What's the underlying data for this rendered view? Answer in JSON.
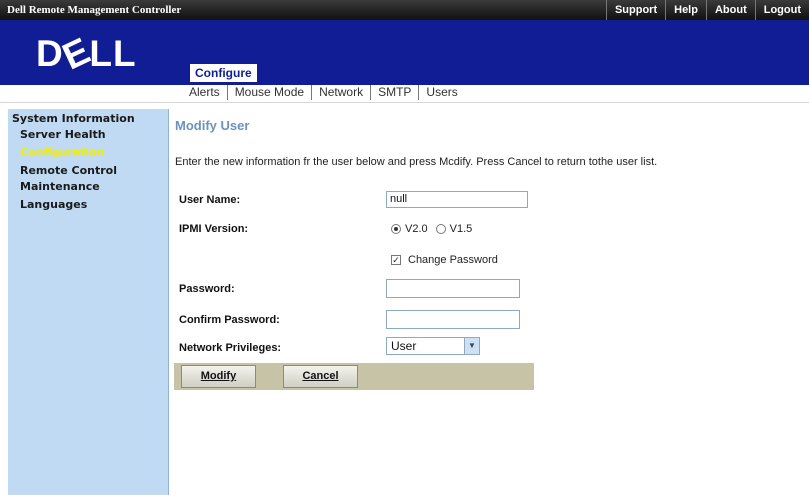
{
  "topbar": {
    "app_title": "Dell Remote Management Controller",
    "links": [
      "Support",
      "Help",
      "About",
      "Logout"
    ]
  },
  "header": {
    "logo": "DELL",
    "active_tab": "Configure",
    "subnav": [
      "Alerts",
      "Mouse Mode",
      "Network",
      "SMTP",
      "Users"
    ]
  },
  "sidebar": {
    "items": [
      "System Information",
      "Server Health",
      "Configuration",
      "Remote Control",
      "Maintenance",
      "Languages"
    ],
    "active_index": 2,
    "active_color": "#f2ee00"
  },
  "form": {
    "title": "Modify User",
    "instructions": "Enter the new information fr the user below and press Mcdify. Press Cancel to return tothe user list.",
    "username_label": "User Name:",
    "username_value": "null",
    "ipmi_label": "IPMI Version:",
    "ipmi_options": [
      "V2.0",
      "V1.5"
    ],
    "ipmi_selected": "V2.0",
    "change_password_label": "Change Password",
    "change_password_checked": true,
    "password_label": "Password:",
    "password_value": "",
    "confirm_label": "Confirm Password:",
    "confirm_value": "",
    "privileges_label": "Network Privileges:",
    "privileges_value": "User",
    "modify_label": "Modify",
    "cancel_label": "Cancel"
  },
  "colors": {
    "header_bg": "#101d94",
    "sidebar_bg": "#c1daf3",
    "title_color": "#6a93bd",
    "button_bar_bg": "#c6c3a6"
  },
  "icons": {
    "select_arrow": "chevron-down-icon",
    "checkbox": "checkmark-icon"
  }
}
